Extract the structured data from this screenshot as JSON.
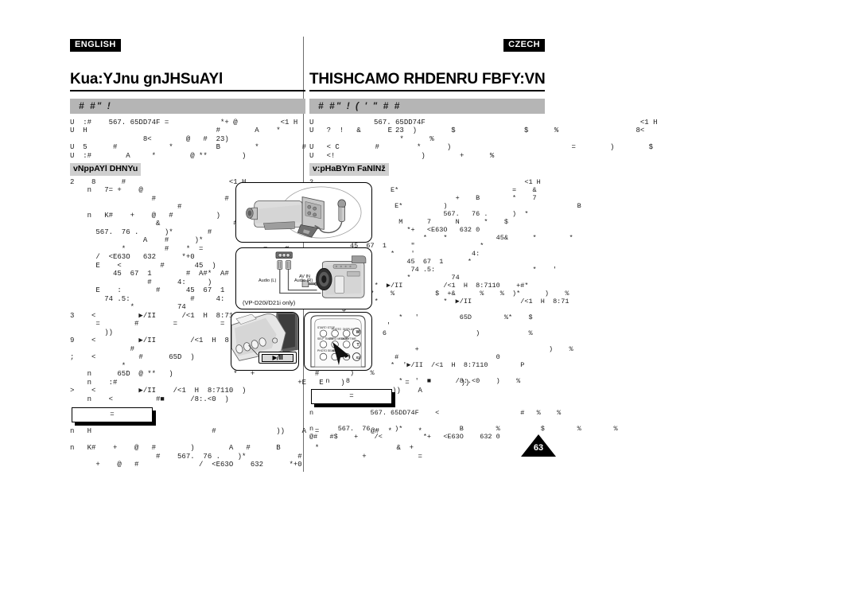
{
  "document": {
    "page_number": "63",
    "left_column": {
      "language_badge": "ENGLISH",
      "page_title": "Kua:YJnu gnJHSuAYl",
      "section_band": "#  #\" !",
      "intro_text": "U  :#    567. 65DD74F =            *+ @          <1 H\nU  H                              #        A    *                         E\n                 8<        @   #  23)\nU  5      #            *          B        *          #                #\nU  :#        A     *        @ **        )",
      "sub_heading": "vNppAYl DHNYu",
      "body_block_1": "2    8      #                        <1 H\n    n   7= +    @                          B         *\n                   #                #              #     B\n                         #\n    n   K#    +    @   #          )        A   #      B\n                    &                 #\n      567.  76 .      )*        #\n                 A    #      )*                              #\n            *         #    *  =              =    #\n      /  <E63O   632      *+0\n      E    <         #       45  )          &                #\n          45  67  1        #  A#*  A#\n                  #      4:     )\n      E    :        #      45  67  1      #  A#*  A#\n        74 .5:              #     4:     )\n              *          74",
      "body_block_2": "3    <          ▶/II      /<1  H  8:7110  )\n      =        #        =          =    #\n        ))\n9    <          ▶/II        /<1  H  8:7110  )\n              #\n;    <          #      65D  )                    #\n            *\n    n      65D  @ **   )              *   +              #\n    n    :#                                          +E   E    )              =            ))\n>    <          ▶/II    /<1  H  8:7110  )                                  ))    A\n    n    <          #■      /8:.<0  )                        #      ))    A",
      "note_label": "=",
      "body_block_3": "n   H                            #              ))    A  =            @#  *      *\n\nn   K#    +    @   #        )        A   #      B        *                  &  +\n                    #    567.  76 .    )*            #              +            =\n      +    @   #              /  <E63O    632      *+0"
    },
    "right_column": {
      "language_badge": "CZECH",
      "page_title": "THISHCAMO RHDENRU FBFY:VN",
      "section_band": "#  #\" ! ( '         \" #     #",
      "intro_text": "U              567. 65DD74F                                                  <1 H\nU   ?  !   &        23  )        $                $      %                  8<\n                     *      %\nU   < C                  *      )                            =        )        $\nU   <!                    )        +      %",
      "sub_heading": "v:pHaBYm FaNlNž",
      "body_block_1": "2                                                    <1 H\n      n      #      E*                            =    &\n                                    +    B        *    7\n      n   <          E*          )                                B\n              &                  567.   76 .      )  *\n                      M      7      N      *    $\n            /<          *+   <E63O   632 0\n      E    8                *    *            45&      *        *\n          45  67  1      \"                *\n                    *    '              4:\n      E  .  %'          45  67  1      *\n              *          74 .5:                        *    '\n            4:          *          74",
      "body_block_2": "3    8          *  ▶/II          /<1  H  8:7110    +#*\n      '        *    %          $  +&      %    %  )*      )    %\n9    .          *                *  ▶/II            /<1  H  8:71\n        $\n;    8                *   '          65D        %*    $\n            *      '\n    n    4    1   6                      )            %\n            65D\n    n    ?                +                                )    %\n            /        #                        0\n>    8              *  '▶/II  /<1  H  8:7110        P\n          )    %\n    n    8            *   '  ■      /8:.<0    )    %",
      "note_label": "=",
      "body_block_3": "n              567. 65DD74F    <                    #   %    %\n\nn      567.  76 .    )*              B        %          $        %        %\n@#   #$    +    /<          *+   <E63O    632 0"
    },
    "panels": {
      "mic": {
        "name": "camcorder-with-external-microphone"
      },
      "av": {
        "caption": "(VP-D20i/D21i only)",
        "label_audio_l": "Audio (L)",
        "label_audio_r": "Audio (R)",
        "label_av_in": "AV IN"
      },
      "button": {
        "callout_label": "▶/II"
      },
      "remote": {
        "keys": [
          "START/ STOP",
          "PHOTO",
          "DISPLAY",
          "SELF TIMER",
          "ZERO MEMORY",
          "DATE/ TIME",
          "PHOTO SEARCH",
          "A.DUB",
          "▶"
        ],
        "zoom_wide": "W",
        "zoom_tele": "T",
        "zoom_x2": "X2"
      }
    }
  }
}
